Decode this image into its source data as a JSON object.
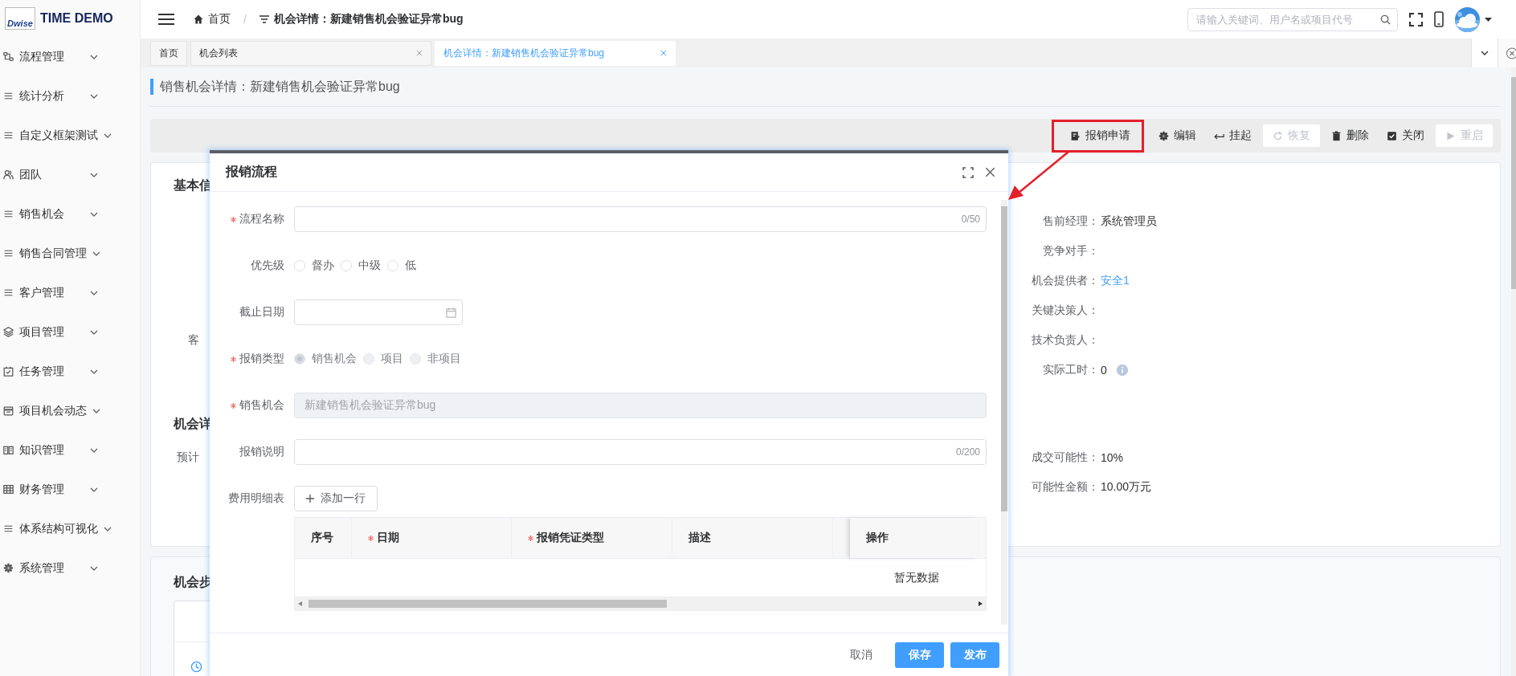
{
  "app": {
    "logo_text": "Dwise",
    "title": "TIME DEMO"
  },
  "sidebar": {
    "items": [
      {
        "label": "流程管理"
      },
      {
        "label": "统计分析"
      },
      {
        "label": "自定义框架测试"
      },
      {
        "label": "团队"
      },
      {
        "label": "销售机会"
      },
      {
        "label": "销售合同管理"
      },
      {
        "label": "客户管理"
      },
      {
        "label": "项目管理"
      },
      {
        "label": "任务管理"
      },
      {
        "label": "项目机会动态"
      },
      {
        "label": "知识管理"
      },
      {
        "label": "财务管理"
      },
      {
        "label": "体系结构可视化"
      },
      {
        "label": "系统管理"
      }
    ]
  },
  "header": {
    "breadcrumb": [
      {
        "label": "首页"
      },
      {
        "label": "机会详情：新建销售机会验证异常bug"
      }
    ],
    "separator": "/",
    "search": {
      "placeholder": "请输入关键词、用户名或项目代号"
    }
  },
  "tabs": [
    {
      "label": "首页",
      "selected": false,
      "closable": false
    },
    {
      "label": "机会列表",
      "selected": false,
      "closable": true
    },
    {
      "label": "机会详情：新建销售机会验证异常bug",
      "selected": true,
      "closable": true
    }
  ],
  "page_title": "销售机会详情：新建销售机会验证异常bug",
  "toolbar": [
    {
      "label": "报销申请",
      "disabled": false,
      "highlighted": true
    },
    {
      "label": "编辑",
      "disabled": false,
      "highlighted": false
    },
    {
      "label": "挂起",
      "disabled": false,
      "highlighted": false
    },
    {
      "label": "恢复",
      "disabled": true,
      "highlighted": false
    },
    {
      "label": "删除",
      "disabled": false,
      "highlighted": false
    },
    {
      "label": "关闭",
      "disabled": false,
      "highlighted": false
    },
    {
      "label": "重启",
      "disabled": true,
      "highlighted": false
    }
  ],
  "basic_info": {
    "heading": "基本信",
    "left_labels": [
      "客"
    ],
    "fields": [
      {
        "label": "售前经理：",
        "value": "系统管理员",
        "link": false,
        "info": false
      },
      {
        "label": "竞争对手："
      },
      {
        "label": "机会提供者：",
        "value": "安全1",
        "link": true,
        "info": false
      },
      {
        "label": "关键决策人："
      },
      {
        "label": "技术负责人："
      },
      {
        "label": "实际工时：",
        "value": "0",
        "link": false,
        "info": true
      }
    ]
  },
  "opportunity_details": {
    "heading": "机会详",
    "left_labels": [
      "预计"
    ],
    "fields": [
      {
        "label": "成交可能性：",
        "value": "10%",
        "link": false,
        "info": false
      },
      {
        "label": "可能性金额：",
        "value": "10.00万元",
        "link": false,
        "info": false
      }
    ]
  },
  "steps": {
    "heading": "机会步"
  },
  "dialog": {
    "title": "报销流程",
    "fields": [
      {
        "kind": "text",
        "label": "流程名称",
        "required": true,
        "disabled": false,
        "counter": "0/50"
      },
      {
        "kind": "radio",
        "label": "优先级",
        "required": false,
        "disabled": false,
        "options": [
          {
            "label": "督办",
            "selected": false
          },
          {
            "label": "中级",
            "selected": false
          },
          {
            "label": "低",
            "selected": false
          }
        ]
      },
      {
        "kind": "date",
        "label": "截止日期",
        "required": false
      },
      {
        "kind": "radio",
        "label": "报销类型",
        "required": true,
        "disabled": true,
        "options": [
          {
            "label": "销售机会",
            "selected": true
          },
          {
            "label": "项目",
            "selected": false
          },
          {
            "label": "非项目",
            "selected": false
          }
        ]
      },
      {
        "kind": "text",
        "label": "销售机会",
        "required": true,
        "disabled": true,
        "value": "新建销售机会验证异常bug"
      },
      {
        "kind": "text",
        "label": "报销说明",
        "required": false,
        "disabled": false,
        "counter": "0/200"
      },
      {
        "kind": "table",
        "label": "费用明细表",
        "required": false,
        "add_button": "添加一行",
        "columns": [
          {
            "label": "序号",
            "required": false
          },
          {
            "label": "日期",
            "required": true
          },
          {
            "label": "报销凭证类型",
            "required": true
          },
          {
            "label": "描述",
            "required": false
          },
          {
            "label": "操作",
            "required": false
          }
        ],
        "empty_text": "暂无数据"
      }
    ],
    "buttons": [
      {
        "label": "取消",
        "kind": "text"
      },
      {
        "label": "保存",
        "kind": "primary"
      },
      {
        "label": "发布",
        "kind": "primary"
      }
    ]
  }
}
